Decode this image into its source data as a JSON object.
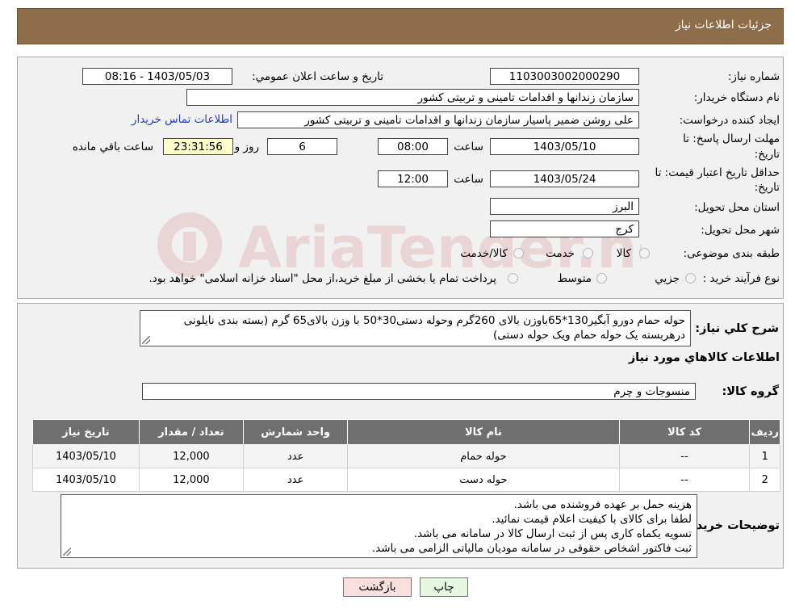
{
  "header": {
    "title": "جزئیات اطلاعات نیاز"
  },
  "labels": {
    "need_number": "شماره نیاز:",
    "announce_datetime": "تاریخ و ساعت اعلان عمومي:",
    "buyer_org": "نام دستگاه خریدار:",
    "requester": "ایجاد کننده درخواست:",
    "deadline_line1": "مهلت ارسال پاسخ: تا",
    "deadline_line2": "تاریخ:",
    "validity_line1": "حداقل تاریخ اعتبار قیمت: تا",
    "validity_line2": "تاریخ:",
    "time_word": "ساعت",
    "day_and": "روز و",
    "remaining": "ساعت باقي مانده",
    "province": "استان محل تحویل:",
    "city": "شهر محل تحویل:",
    "category": "طبقه بندی موضوعی:",
    "process_type": "نوع فرآیند خرید :"
  },
  "values": {
    "need_number": "1103003002000290",
    "announce_datetime": "1403/05/03 - 08:16",
    "buyer_org": "سازمان زندانها و اقدامات تامینی و تربیتی کشور",
    "requester": "علی روشن ضمیر پاسیار سازمان زندانها و اقدامات تامینی و تربیتی کشور",
    "contact_link": "اطلاعات تماس خریدار",
    "deadline_date": "1403/05/10",
    "deadline_time": "08:00",
    "days": "6",
    "remaining_time": "23:31:56",
    "validity_date": "1403/05/24",
    "validity_time": "12:00",
    "province": "البرز",
    "city": "کرج"
  },
  "category_options": [
    "کالا",
    "خدمت",
    "کالا/خدمت"
  ],
  "process_options": [
    "جزيي",
    "متوسط"
  ],
  "process_note": "پرداخت تمام یا بخشی از مبلغ خرید،از محل \"اسناد خزانه اسلامی\" خواهد بود.",
  "description": {
    "label": "شرح کلي نياز:",
    "text": "حوله حمام دورو آبگیر130*65باوزن بالای 260گرم وحوله دستی30*50 با وزن بالای65 گرم (بسته بندی نایلونی درهربسته یک حوله حمام ویک حوله دستی)"
  },
  "goods_title": "اطلاعات کالاهاي مورد نياز",
  "goods_group": {
    "label": "گروه کالا:",
    "value": "منسوجات و چرم"
  },
  "table": {
    "headers": [
      "رديف",
      "کد کالا",
      "نام کالا",
      "واحد شمارش",
      "تعداد / مقدار",
      "تاریخ نیاز"
    ],
    "rows": [
      [
        "1",
        "--",
        "حوله حمام",
        "عدد",
        "12,000",
        "1403/05/10"
      ],
      [
        "2",
        "--",
        "حوله دست",
        "عدد",
        "12,000",
        "1403/05/10"
      ]
    ]
  },
  "buyer_notes": {
    "label": "توضیحات خریدار:",
    "lines": [
      "هزینه حمل بر عهده فروشنده می باشد.",
      "لطفا برای کالای با کیفیت اعلام قیمت نمائید.",
      "تسویه یکماه کاری پس از ثبت ارسال کالا در سامانه می باشد.",
      "ثبت فاکتور اشخاص حقوقی در سامانه مودیان مالیاتی الزامی می باشد."
    ]
  },
  "buttons": {
    "print": "چاپ",
    "back": "بازگشت"
  },
  "watermark": {
    "text": "AriaTender.neT"
  },
  "colors": {
    "header_bg": "#8e6d4a",
    "table_header": "#6f6f6f",
    "link": "#1d3fd0",
    "back_btn": "#fbdede",
    "print_btn": "#e6f7e0"
  }
}
